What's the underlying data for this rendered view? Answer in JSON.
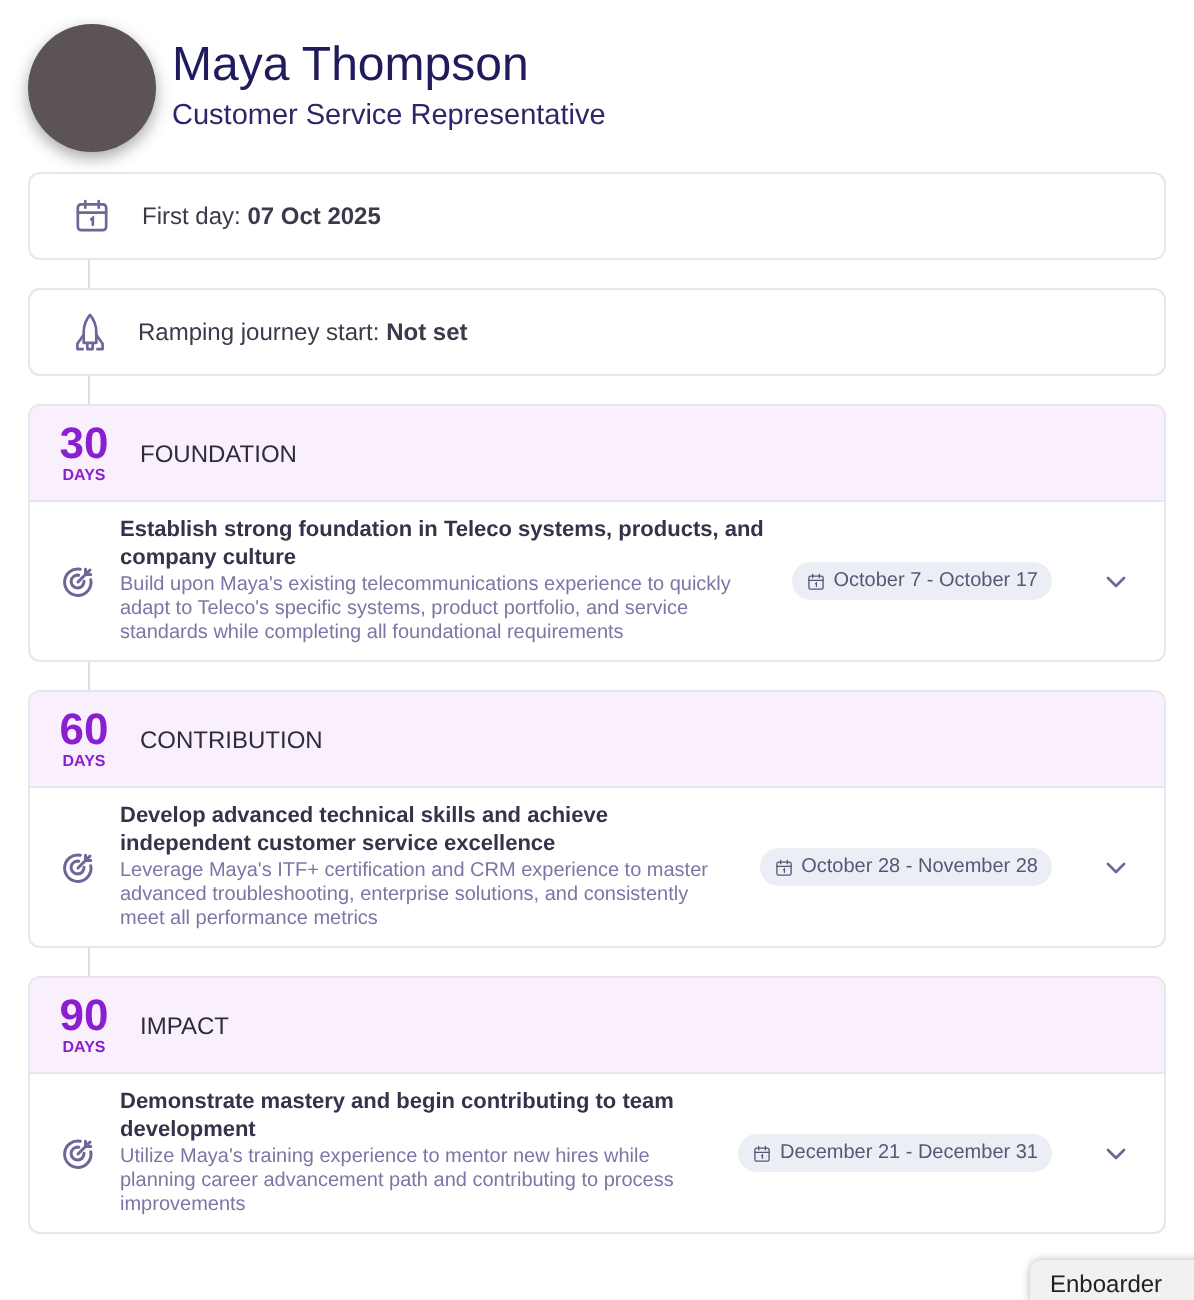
{
  "profile": {
    "name": "Maya Thompson",
    "role": "Customer Service Representative"
  },
  "milestones": [
    {
      "kind": "calendar",
      "label": "First day:",
      "value": "07 Oct 2025"
    },
    {
      "kind": "rocket",
      "label": "Ramping journey start:",
      "value": "Not set"
    }
  ],
  "phases": [
    {
      "number": "30",
      "unit": "DAYS",
      "title": "FOUNDATION",
      "goal": {
        "title": "Establish strong foundation in Teleco systems, products, and company culture",
        "description": "Build upon Maya's existing telecommunications experience to quickly adapt to Teleco's specific systems, product portfolio, and service standards while completing all foundational requirements",
        "dates": "October 7 - October 17",
        "expanded": false
      }
    },
    {
      "number": "60",
      "unit": "DAYS",
      "title": "CONTRIBUTION",
      "goal": {
        "title": "Develop advanced technical skills and achieve independent customer service excellence",
        "description": "Leverage Maya's ITF+ certification and CRM experience to master advanced troubleshooting, enterprise solutions, and consistently meet all performance metrics",
        "dates": "October 28 - November 28",
        "expanded": false
      }
    },
    {
      "number": "90",
      "unit": "DAYS",
      "title": "IMPACT",
      "goal": {
        "title": "Demonstrate mastery and begin contributing to team development",
        "description": "Utilize Maya's training experience to mentor new hires while planning career advancement path and contributing to process improvements",
        "dates": "December 21 - December 31",
        "expanded": false
      }
    }
  ],
  "floating_tab": {
    "label": "Enboarder"
  }
}
